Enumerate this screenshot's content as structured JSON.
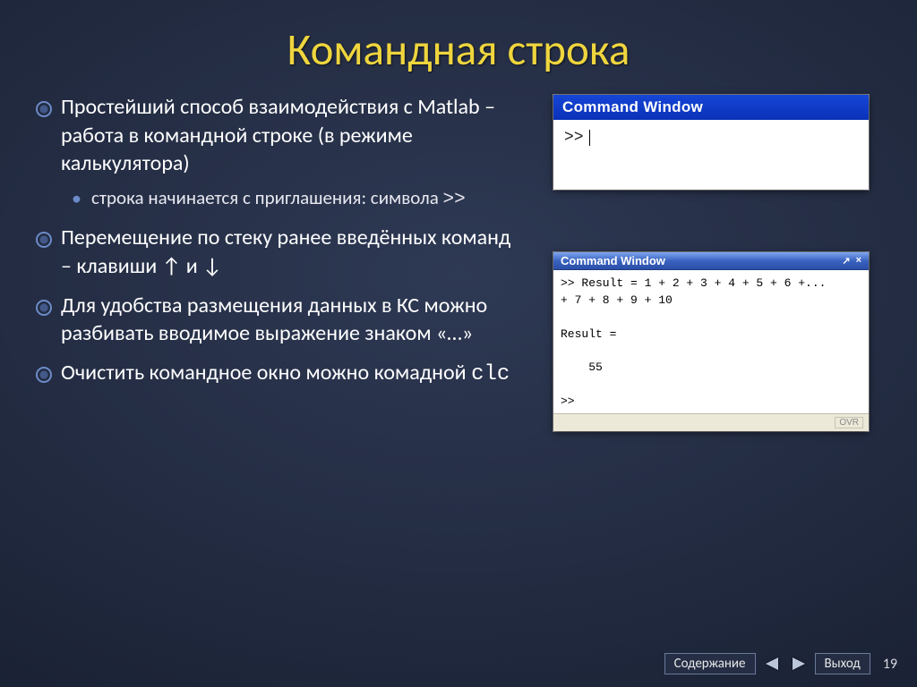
{
  "title": "Командная строка",
  "bullets": [
    "Простейший способ взаимодействия с Matlab – работа в командной строке (в режиме калькулятора)",
    "Перемещение по стеку ранее введённых команд – клавиши ↑ и ↓",
    "Для удобства размещения данных в КС можно разбивать вводимое выражение знаком «…»",
    "Очистить командное окно можно комадной "
  ],
  "sub_bullet": "строка начинается с приглашения: символа ",
  "prompt_symbol": ">>",
  "clc": "clc",
  "cw1": {
    "title": "Command Window",
    "prompt": ">>"
  },
  "cw2": {
    "title": "Command Window",
    "body": ">> Result = 1 + 2 + 3 + 4 + 5 + 6 +...\n+ 7 + 8 + 9 + 10\n\nResult =\n\n    55\n\n>>",
    "status": "OVR"
  },
  "footer": {
    "contents": "Содержание",
    "exit": "Выход",
    "page": "19"
  }
}
